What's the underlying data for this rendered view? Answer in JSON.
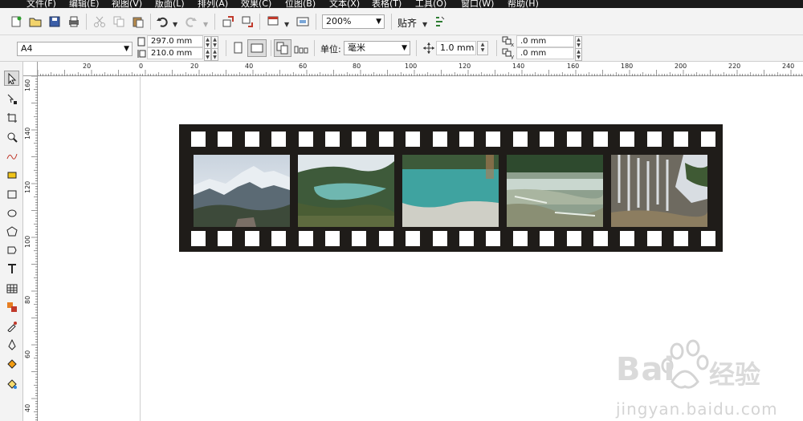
{
  "menu": {
    "items": [
      "文件(F)",
      "编辑(E)",
      "视图(V)",
      "版面(L)",
      "排列(A)",
      "效果(C)",
      "位图(B)",
      "文本(X)",
      "表格(T)",
      "工具(O)",
      "窗口(W)",
      "帮助(H)"
    ]
  },
  "standard_toolbar": {
    "zoom_value": "200%",
    "snap_label": "贴齐"
  },
  "property_bar": {
    "page_size": "A4",
    "width_value": "297.0 mm",
    "height_value": "210.0 mm",
    "unit_label": "单位:",
    "unit_value": "毫米",
    "nudge_value": "1.0 mm",
    "dup_x_value": ".0 mm",
    "dup_y_value": ".0 mm"
  },
  "rulers": {
    "horizontal_ticks": [
      "20",
      "0",
      "20",
      "40",
      "60",
      "80",
      "100",
      "120",
      "140",
      "160",
      "180",
      "200",
      "220",
      "240"
    ],
    "vertical_ticks": [
      "160",
      "140",
      "120",
      "100",
      "80",
      "60",
      "40"
    ]
  },
  "film_strip": {
    "photos": [
      "snow-mountain",
      "lake-valley",
      "turquoise-water",
      "travertine-terraces",
      "waterfall-cliff"
    ]
  },
  "watermark": {
    "brand": "Bai",
    "brand_suffix": "经验",
    "url": "jingyan.baidu.com"
  },
  "colors": {
    "menubar": "#1a1a1a",
    "toolbar": "#f3f3f3",
    "film": "#1f1c19"
  }
}
